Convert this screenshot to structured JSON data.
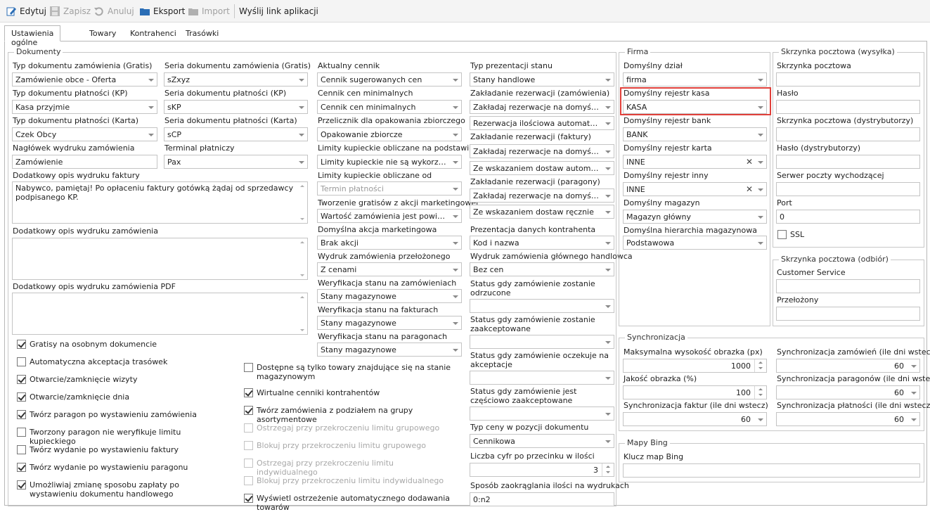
{
  "toolbar": {
    "edit": "Edytuj",
    "save": "Zapisz",
    "cancel": "Anuluj",
    "export": "Eksport",
    "import": "Import",
    "send_link": "Wyślij link aplikacji"
  },
  "tabs": [
    "Ustawienia ogólne",
    "Towary",
    "Kontrahenci",
    "Trasówki"
  ],
  "dokumenty": {
    "title": "Dokumenty",
    "col1": {
      "typ_zam_gratis_label": "Typ dokumentu zamówienia (Gratis)",
      "typ_zam_gratis": "Zamówienie obce - Oferta",
      "typ_plat_kp_label": "Typ dokumentu płatności (KP)",
      "typ_plat_kp": "Kasa przyjmie",
      "typ_plat_karta_label": "Typ dokumentu płatności (Karta)",
      "typ_plat_karta": "Czek Obcy",
      "naglowek_label": "Nagłówek wydruku zamówienia",
      "naglowek": "Zamówienie",
      "seria_zam_gratis_label": "Seria dokumentu zamówienia (Gratis)",
      "seria_zam_gratis": "sZxyz",
      "seria_plat_kp_label": "Seria dokumentu płatności (KP)",
      "seria_plat_kp": "sKP",
      "seria_plat_karta_label": "Seria dokumentu płatności (Karta)",
      "seria_plat_karta": "sCP",
      "terminal_label": "Terminal płatniczy",
      "terminal": "Pax",
      "opis_faktury_label": "Dodatkowy opis wydruku faktury",
      "opis_faktury": "Nabywco, pamiętaj! Po opłaceniu faktury gotówką żądaj od sprzedawcy podpisanego KP.",
      "opis_zam_label": "Dodatkowy opis wydruku zamówienia",
      "opis_zam": "",
      "opis_pdf_label": "Dodatkowy opis wydruku zamówienia PDF",
      "opis_pdf": ""
    },
    "checks_left": [
      {
        "label": "Gratisy na osobnym dokumencie",
        "checked": true
      },
      {
        "label": "Automatyczna akceptacja trasówek",
        "checked": false
      },
      {
        "label": "Otwarcie/zamknięcie wizyty",
        "checked": true
      },
      {
        "label": "Otwarcie/zamknięcie dnia",
        "checked": true
      },
      {
        "label": "Twórz paragon po wystawieniu zamówienia",
        "checked": true
      },
      {
        "label": "Tworzony paragon nie weryfikuje limitu kupieckiego",
        "checked": false
      },
      {
        "label": "Twórz wydanie po wystawieniu faktury",
        "checked": false
      },
      {
        "label": "Twórz wydanie po wystawieniu paragonu",
        "checked": true
      },
      {
        "label": "Umożliwiaj zmianę sposobu zapłaty po wystawieniu dokumentu handlowego",
        "checked": true
      }
    ],
    "col3": {
      "cennik_label": "Aktualny cennik",
      "cennik": "Cennik sugerowanych cen",
      "cennik_min_label": "Cennik cen minimalnych",
      "cennik_min": "Cennik cen minimalnych",
      "przelicznik_label": "Przelicznik dla opakowania zbiorczego",
      "przelicznik": "Opakowanie zbiorcze",
      "limity_label": "Limity kupieckie obliczane na podstawie",
      "limity": "Limity kupieckie nie są wykorzystywane",
      "limity_od_label": "Limity kupieckie obliczane od",
      "limity_od": "Termin płatności",
      "gratisy_label": "Tworzenie gratisów z akcji marketingowej",
      "gratisy": "Wartość zamówienia jest powiększana",
      "akcja_label": "Domyślna akcja marketingowa",
      "akcja": "Brak akcji",
      "wydruk_przel_label": "Wydruk zamówienia przełożonego",
      "wydruk_przel": "Z cenami",
      "wer_zam_label": "Weryfikacja stanu na zamówieniach",
      "wer_zam": "Stany magazynowe",
      "wer_fakt_label": "Weryfikacja stanu na fakturach",
      "wer_fakt": "Stany magazynowe",
      "wer_par_label": "Weryfikacja stanu na paragonach",
      "wer_par": "Stany magazynowe"
    },
    "checks_mid": [
      {
        "label": "Dostępne są tylko towary znajdujące się na stanie magazynowym",
        "checked": false,
        "disabled": false
      },
      {
        "label": "Wirtualne cenniki kontrahentów",
        "checked": true,
        "disabled": false
      },
      {
        "label": "Twórz zamówienia z podziałem na grupy asortymentowe",
        "checked": true,
        "disabled": false
      },
      {
        "label": "Ostrzegaj przy przekroczeniu limitu grupowego",
        "checked": false,
        "disabled": true
      },
      {
        "label": "Blokuj przy przekroczeniu limitu grupowego",
        "checked": false,
        "disabled": true
      },
      {
        "label": "Ostrzegaj przy przekroczeniu limitu indywidualnego",
        "checked": false,
        "disabled": true
      },
      {
        "label": "Blokuj przy przekroczeniu limitu indywidualnego",
        "checked": false,
        "disabled": true
      },
      {
        "label": "Wyświetl ostrzeżenie automatycznego dodawania towarów",
        "checked": true,
        "disabled": false
      }
    ],
    "col4": {
      "typ_prez_label": "Typ prezentacji stanu",
      "typ_prez": "Stany handlowe",
      "rez_zam_label": "Zakładanie rezerwacji (zamówienia)",
      "rez_zam": "Zakładaj rezerwacje na domyślnym magazynie",
      "rez_zam2": "Rezerwacja ilościowa automatyczna",
      "rez_fakt_label": "Zakładanie rezerwacji (faktury)",
      "rez_fakt": "Zakładaj rezerwacje na domyślnym magazynie",
      "rez_fakt2": "Ze wskazaniem dostaw automatycznym",
      "rez_par_label": "Zakładanie rezerwacji (paragony)",
      "rez_par": "Zakładaj rezerwacje na domyślnym magazynie",
      "rez_par2": "Ze wskazaniem dostaw ręcznie",
      "prez_kontr_label": "Prezentacja danych kontrahenta",
      "prez_kontr": "Kod i nazwa",
      "wydruk_gl_label": "Wydruk zamówienia głównego handlowca",
      "wydruk_gl": "Bez cen",
      "status_odrz_label": "Status gdy zamówienie zostanie odrzucone",
      "status_odrz": "",
      "status_zaak_label": "Status gdy zamówienie zostanie zaakceptowane",
      "status_zaak": "",
      "status_ocz_label": "Status gdy zamówienie oczekuje na akceptacje",
      "status_ocz": "",
      "status_cz_label": "Status gdy zamówienie jest częściowo zaakceptowane",
      "status_cz": "",
      "typ_ceny_label": "Typ ceny w pozycji dokumentu",
      "typ_ceny": "Cennikowa",
      "liczba_cyfr_label": "Liczba cyfr po przecinku w ilości",
      "liczba_cyfr": "3",
      "zaokr_label": "Sposób zaokrąglania ilości na wydrukach",
      "zaokr": "0:n2"
    }
  },
  "firma": {
    "title": "Firma",
    "dzial_label": "Domyślny dział",
    "dzial": "firma",
    "kasa_label": "Domyślny rejestr kasa",
    "kasa": "KASA",
    "bank_label": "Domyślny rejestr bank",
    "bank": "BANK",
    "karta_label": "Domyślny rejestr karta",
    "karta": "INNE",
    "inny_label": "Domyślny rejestr inny",
    "inny": "INNE",
    "magazyn_label": "Domyślny magazyn",
    "magazyn": "Magazyn główny",
    "hierarchia_label": "Domyślna hierarchia magazynowa",
    "hierarchia": "Podstawowa",
    "clear_glyph": "✕"
  },
  "wysylka": {
    "title": "Skrzynka pocztowa (wysyłka)",
    "skrzynka_label": "Skrzynka pocztowa",
    "skrzynka": "",
    "haslo_label": "Hasło",
    "haslo": "",
    "skrzynka_dystr_label": "Skrzynka pocztowa (dystrybutorzy)",
    "skrzynka_dystr": "",
    "haslo_dystr_label": "Hasło (dystrybutorzy)",
    "haslo_dystr": "",
    "serwer_label": "Serwer poczty wychodzącej",
    "serwer": "",
    "port_label": "Port",
    "port": "0",
    "ssl_label": "SSL",
    "ssl": false
  },
  "odbior": {
    "title": "Skrzynka pocztowa (odbiór)",
    "cs_label": "Customer Service",
    "cs": "",
    "przelozony_label": "Przełożony",
    "przelozony": ""
  },
  "sync": {
    "title": "Synchronizacja",
    "max_obrazka_label": "Maksymalna wysokość obrazka (px)",
    "max_obrazka": "1000",
    "jakosc_label": "Jakość obrazka (%)",
    "jakosc": "100",
    "faktur_label": "Synchronizacja faktur (ile dni wstecz)",
    "faktur": "60",
    "zamowien_label": "Synchronizacja zamówień (ile dni wstecz)",
    "zamowien": "60",
    "paragonow_label": "Synchronizacja paragonów (ile dni wstecz)",
    "paragonow": "60",
    "platnosci_label": "Synchronizacja płatności (ile dni wstecz)",
    "platnosci": "60"
  },
  "bing": {
    "title": "Mapy Bing",
    "klucz_label": "Klucz map Bing",
    "klucz": ""
  },
  "colors": {
    "highlight": "#e0403a",
    "export_icon": "#2a6db5",
    "edit_icon": "#2a6db5"
  },
  "icons": {
    "edit": "pencil-icon",
    "save": "floppy-icon",
    "cancel": "undo-icon",
    "export": "folder-icon",
    "import": "folder-icon"
  }
}
